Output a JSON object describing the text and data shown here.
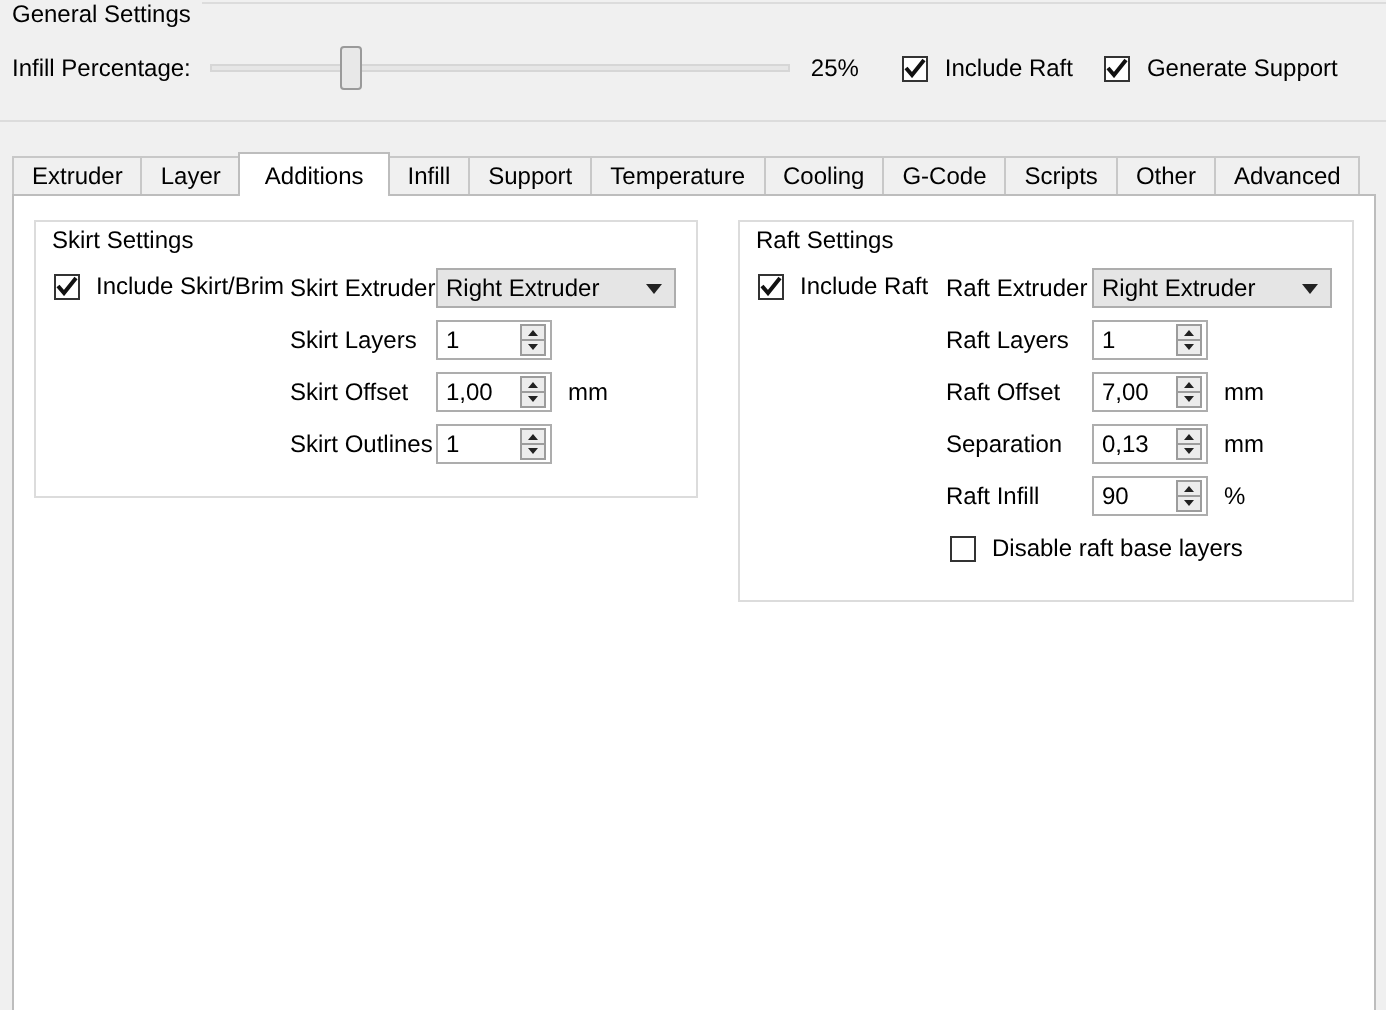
{
  "general": {
    "title": "General Settings",
    "infill_label": "Infill Percentage:",
    "infill": {
      "level": 0.24,
      "reading": "25%"
    },
    "checkboxes": [
      {
        "label": "Include Raft",
        "checked": true
      },
      {
        "label": "Generate Support",
        "checked": true
      }
    ]
  },
  "tabs": [
    {
      "label": "Extruder",
      "selected": false
    },
    {
      "label": "Layer",
      "selected": false
    },
    {
      "label": "Additions",
      "selected": true
    },
    {
      "label": "Infill",
      "selected": false
    },
    {
      "label": "Support",
      "selected": false
    },
    {
      "label": "Temperature",
      "selected": false
    },
    {
      "label": "Cooling",
      "selected": false
    },
    {
      "label": "G-Code",
      "selected": false
    },
    {
      "label": "Scripts",
      "selected": false
    },
    {
      "label": "Other",
      "selected": false
    },
    {
      "label": "Advanced",
      "selected": false
    }
  ],
  "groups": [
    {
      "title": "Skirt Settings",
      "include": {
        "label": "Include Skirt/Brim",
        "checked": true
      },
      "fields": [
        {
          "kind": "select",
          "label": "Skirt Extruder",
          "value": "Right Extruder"
        },
        {
          "kind": "spin",
          "label": "Skirt Layers",
          "value": "1"
        },
        {
          "kind": "spin",
          "label": "Skirt Offset",
          "value": "1,00",
          "unit": "mm"
        },
        {
          "kind": "spin",
          "label": "Skirt Outlines",
          "value": "1"
        }
      ]
    },
    {
      "title": "Raft Settings",
      "include": {
        "label": "Include Raft",
        "checked": true
      },
      "fields": [
        {
          "kind": "select",
          "label": "Raft Extruder",
          "value": "Right Extruder"
        },
        {
          "kind": "spin",
          "label": "Raft Layers",
          "value": "1"
        },
        {
          "kind": "spin",
          "label": "Raft Offset",
          "value": "7,00",
          "unit": "mm"
        },
        {
          "kind": "spin",
          "label": "Separation",
          "value": "0,13",
          "unit": "mm"
        },
        {
          "kind": "spin",
          "label": "Raft Infill",
          "value": "90",
          "unit": "%"
        },
        {
          "kind": "checkbox",
          "label": "Disable raft base layers",
          "checked": false
        }
      ]
    }
  ]
}
